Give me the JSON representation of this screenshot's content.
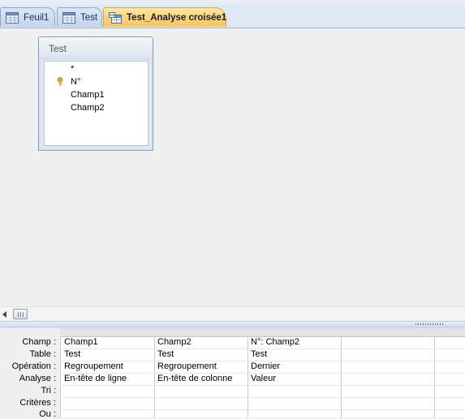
{
  "tabs": [
    {
      "label": "Feuil1",
      "icon": "table-icon",
      "active": false
    },
    {
      "label": "Test",
      "icon": "table-icon",
      "active": false
    },
    {
      "label": "Test_Analyse croisée1",
      "icon": "crosstab-query-icon",
      "active": true
    }
  ],
  "table_box": {
    "title": "Test",
    "fields": [
      "*",
      "N°",
      "Champ1",
      "Champ2"
    ],
    "primary_key_field": "N°"
  },
  "grid": {
    "row_labels": [
      "Champ :",
      "Table :",
      "Opération :",
      "Analyse :",
      "Tri :",
      "Critères :",
      "Ou :"
    ],
    "columns": [
      {
        "champ": "Champ1",
        "table": "Test",
        "operation": "Regroupement",
        "analyse": "En-tête de ligne"
      },
      {
        "champ": "Champ2",
        "table": "Test",
        "operation": "Regroupement",
        "analyse": "En-tête de colonne"
      },
      {
        "champ": "N°: Champ2",
        "table": "Test",
        "operation": "Dernier",
        "analyse": "Valeur"
      },
      {
        "champ": "",
        "table": "",
        "operation": "",
        "analyse": ""
      }
    ]
  },
  "colors": {
    "active_tab": "#f8c45d",
    "tab": "#c4d5ec",
    "workspace": "#f0f0f0"
  }
}
